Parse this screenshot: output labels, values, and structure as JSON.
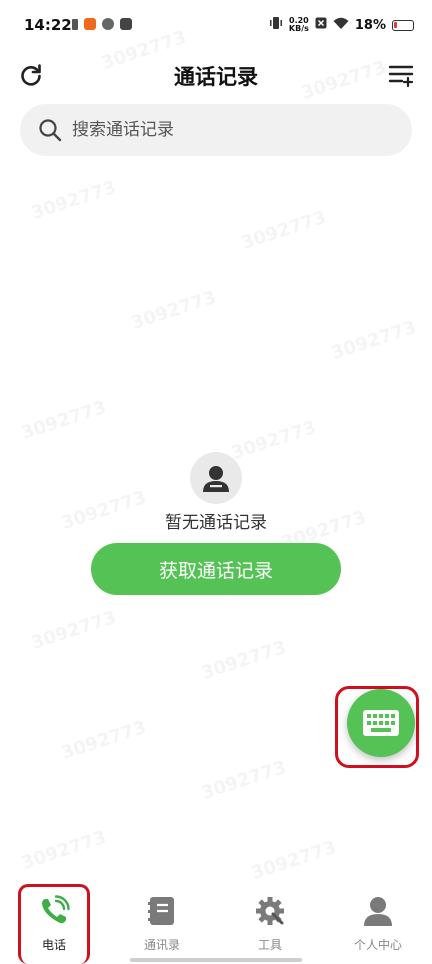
{
  "status_bar": {
    "time": "14:22",
    "network_speed_value": "0.20",
    "network_speed_unit": "KB/s",
    "battery": "18%"
  },
  "header": {
    "title": "通话记录"
  },
  "search": {
    "placeholder": "搜索通话记录"
  },
  "empty_state": {
    "message": "暂无通话记录",
    "button_label": "获取通话记录"
  },
  "bottom_nav": {
    "items": [
      {
        "label": "电话",
        "icon": "phone-icon",
        "active": true
      },
      {
        "label": "通讯录",
        "icon": "contacts-book-icon",
        "active": false
      },
      {
        "label": "工具",
        "icon": "tools-gear-icon",
        "active": false
      },
      {
        "label": "个人中心",
        "icon": "person-icon",
        "active": false
      }
    ]
  },
  "watermark": "3092773",
  "colors": {
    "accent": "#55c256",
    "highlight": "#d0101e",
    "search_bg": "#f1f1f1"
  }
}
